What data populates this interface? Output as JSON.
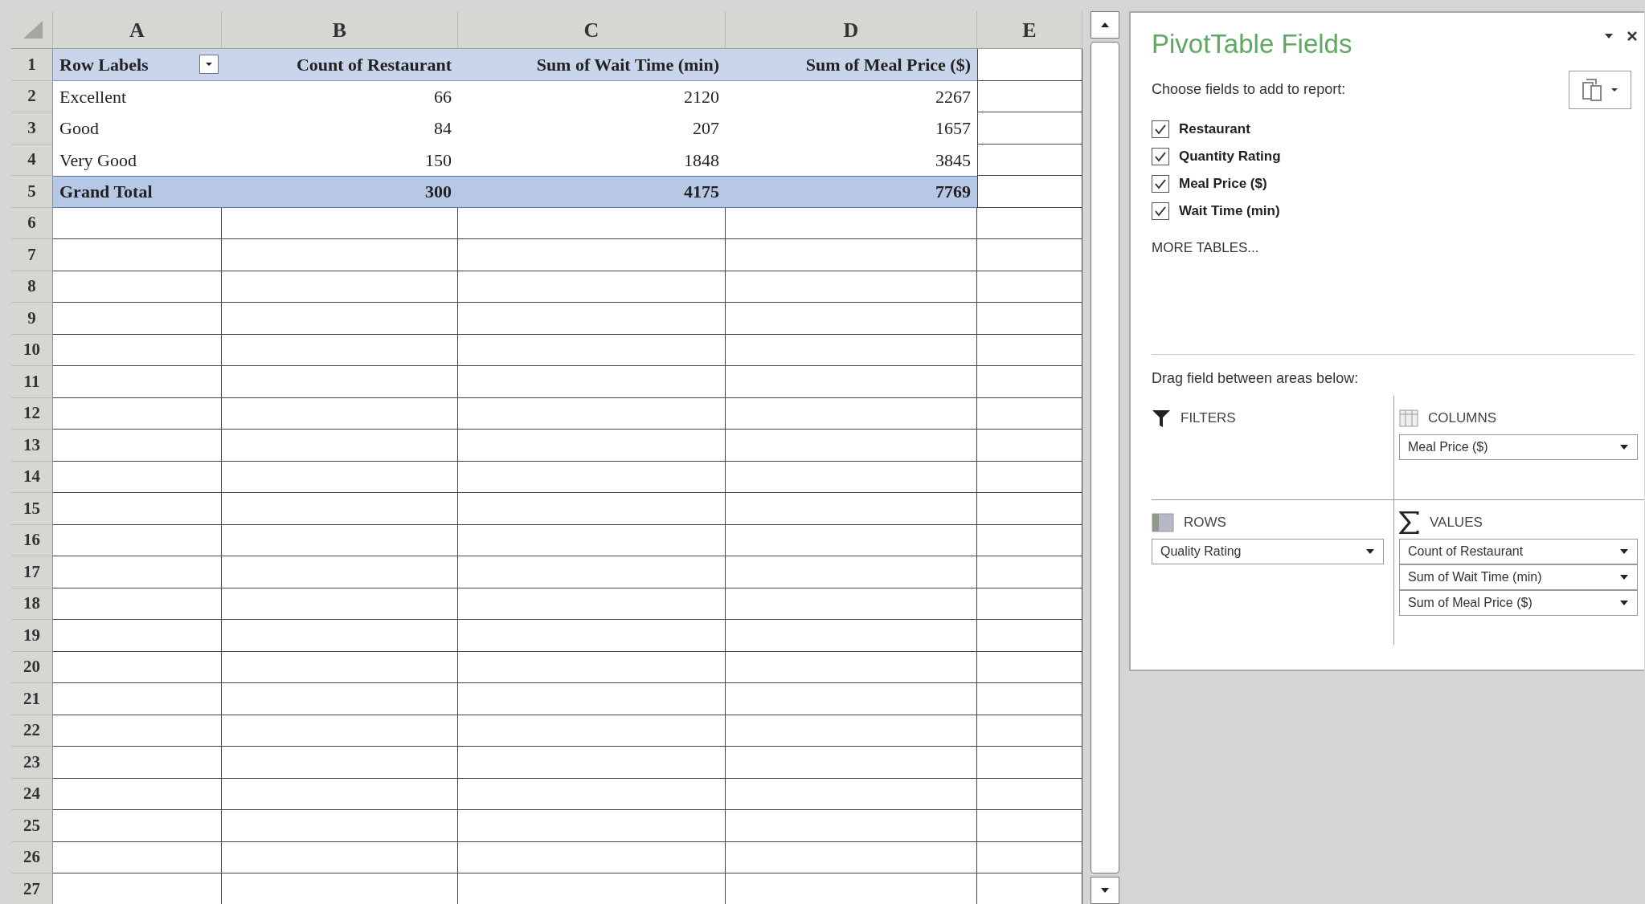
{
  "sheet": {
    "column_headers": [
      "A",
      "B",
      "C",
      "D",
      "E"
    ],
    "rows": [
      {
        "number": "1",
        "kind": "pivot_header",
        "cells": [
          "Row Labels",
          "Count of Restaurant",
          "Sum of Wait Time (min)",
          "Sum of Meal Price ($)"
        ]
      },
      {
        "number": "2",
        "kind": "pivot_data",
        "cells": [
          "Excellent",
          "66",
          "2120",
          "2267"
        ]
      },
      {
        "number": "3",
        "kind": "pivot_data",
        "cells": [
          "Good",
          "84",
          "207",
          "1657"
        ]
      },
      {
        "number": "4",
        "kind": "pivot_data",
        "cells": [
          "Very Good",
          "150",
          "1848",
          "3845"
        ]
      },
      {
        "number": "5",
        "kind": "pivot_total",
        "cells": [
          "Grand Total",
          "300",
          "4175",
          "7769"
        ]
      },
      {
        "number": "6",
        "kind": "empty"
      },
      {
        "number": "7",
        "kind": "empty"
      },
      {
        "number": "8",
        "kind": "empty"
      },
      {
        "number": "9",
        "kind": "empty"
      },
      {
        "number": "10",
        "kind": "empty"
      },
      {
        "number": "11",
        "kind": "empty"
      },
      {
        "number": "12",
        "kind": "empty"
      },
      {
        "number": "13",
        "kind": "empty"
      },
      {
        "number": "14",
        "kind": "empty"
      },
      {
        "number": "15",
        "kind": "empty"
      },
      {
        "number": "16",
        "kind": "empty"
      },
      {
        "number": "17",
        "kind": "empty"
      },
      {
        "number": "18",
        "kind": "empty"
      },
      {
        "number": "19",
        "kind": "empty"
      },
      {
        "number": "20",
        "kind": "empty"
      },
      {
        "number": "21",
        "kind": "empty"
      },
      {
        "number": "22",
        "kind": "empty"
      },
      {
        "number": "23",
        "kind": "empty"
      },
      {
        "number": "24",
        "kind": "empty"
      },
      {
        "number": "25",
        "kind": "empty"
      },
      {
        "number": "26",
        "kind": "empty"
      },
      {
        "number": "27",
        "kind": "empty"
      }
    ]
  },
  "pivot_panel": {
    "title": "PivotTable Fields",
    "subtitle": "Choose fields to add to report:",
    "fields": [
      {
        "label": "Restaurant",
        "checked": true
      },
      {
        "label": "Quantity Rating",
        "checked": true
      },
      {
        "label": "Meal Price ($)",
        "checked": true
      },
      {
        "label": "Wait Time (min)",
        "checked": true
      }
    ],
    "more_tables": "MORE TABLES...",
    "areas_hint": "Drag field between areas below:",
    "areas": [
      {
        "kind": "filters",
        "label": "FILTERS"
      },
      {
        "kind": "columns",
        "label": "COLUMNS",
        "items": [
          "Meal Price ($)"
        ]
      },
      {
        "kind": "rows",
        "label": "ROWS",
        "items": [
          "Quality Rating"
        ]
      },
      {
        "kind": "values",
        "label": "VALUES",
        "items": [
          "Count of Restaurant",
          "Sum of Wait Time (min)",
          "Sum of Meal Price ($)"
        ]
      }
    ]
  }
}
